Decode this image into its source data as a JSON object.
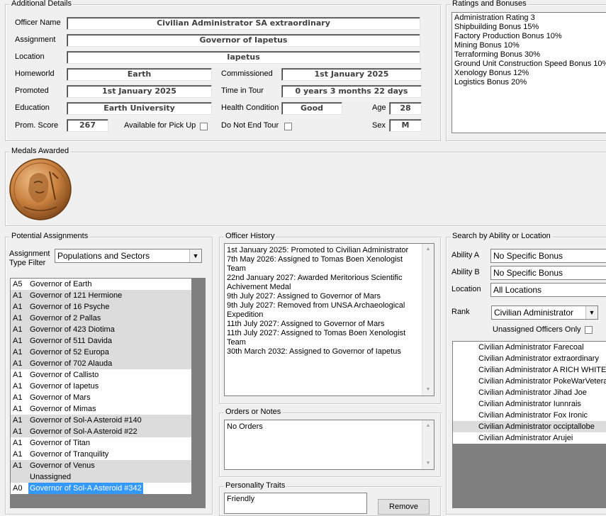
{
  "additional_details": {
    "title": "Additional Details",
    "officer_name_label": "Officer Name",
    "officer_name": "Civilian Administrator SA extraordinary",
    "assignment_label": "Assignment",
    "assignment": "Governor of Iapetus",
    "location_label": "Location",
    "location": "Iapetus",
    "homeworld_label": "Homeworld",
    "homeworld": "Earth",
    "commissioned_label": "Commissioned",
    "commissioned": "1st January 2025",
    "promoted_label": "Promoted",
    "promoted": "1st January 2025",
    "time_in_tour_label": "Time in Tour",
    "time_in_tour": "0 years 3 months 22 days",
    "education_label": "Education",
    "education": "Earth University",
    "health_label": "Health Condition",
    "health": "Good",
    "age_label": "Age",
    "age": "28",
    "prom_score_label": "Prom. Score",
    "prom_score": "267",
    "pickup_label": "Available for Pick Up",
    "do_not_end_tour_label": "Do Not End Tour",
    "sex_label": "Sex",
    "sex": "M"
  },
  "ratings": {
    "title": "Ratings and Bonuses",
    "items": [
      "Administration Rating 3",
      "Shipbuilding Bonus 15%",
      "Factory Production Bonus 10%",
      "Mining Bonus 10%",
      "Terraforming Bonus 30%",
      "Ground Unit Construction Speed Bonus 10%",
      "Xenology Bonus 12%",
      "Logistics Bonus 20%"
    ]
  },
  "medals": {
    "title": "Medals Awarded"
  },
  "potential": {
    "title": "Potential Assignments",
    "filter_label_1": "Assignment",
    "filter_label_2": "Type Filter",
    "filter_value": "Populations and Sectors",
    "items": [
      {
        "code": "A5",
        "name": "Governor of Earth",
        "alt": false
      },
      {
        "code": "A1",
        "name": "Governor of 121 Hermione",
        "alt": true
      },
      {
        "code": "A1",
        "name": "Governor of 16 Psyche",
        "alt": true
      },
      {
        "code": "A1",
        "name": "Governor of 2 Pallas",
        "alt": true
      },
      {
        "code": "A1",
        "name": "Governor of 423 Diotima",
        "alt": true
      },
      {
        "code": "A1",
        "name": "Governor of 511 Davida",
        "alt": true
      },
      {
        "code": "A1",
        "name": "Governor of 52 Europa",
        "alt": true
      },
      {
        "code": "A1",
        "name": "Governor of 702 Alauda",
        "alt": true
      },
      {
        "code": "A1",
        "name": "Governor of Callisto",
        "alt": false
      },
      {
        "code": "A1",
        "name": "Governor of Iapetus",
        "alt": false
      },
      {
        "code": "A1",
        "name": "Governor of Mars",
        "alt": false
      },
      {
        "code": "A1",
        "name": "Governor of Mimas",
        "alt": false
      },
      {
        "code": "A1",
        "name": "Governor of Sol-A Asteroid #140",
        "alt": true
      },
      {
        "code": "A1",
        "name": "Governor of Sol-A Asteroid #22",
        "alt": true
      },
      {
        "code": "A1",
        "name": "Governor of Titan",
        "alt": false
      },
      {
        "code": "A1",
        "name": "Governor of Tranquility",
        "alt": false
      },
      {
        "code": "A1",
        "name": "Governor of Venus",
        "alt": true
      },
      {
        "code": "",
        "name": "Unassigned",
        "alt": true
      },
      {
        "code": "A0",
        "name": "Governor of Sol-A Asteroid #342",
        "alt": false,
        "selected": true
      }
    ]
  },
  "history": {
    "title": "Officer History",
    "lines": [
      "1st January 2025: Promoted to Civilian Administrator",
      "7th May 2026: Assigned to Tomas Boen Xenologist Team",
      "22nd January 2027: Awarded Meritorious Scientific Achivement Medal",
      "9th July 2027: Assigned to Governor of Mars",
      "9th July 2027: Removed from UNSA Archaeological Expedition",
      "11th July 2027: Assigned to Governor of Mars",
      "11th July 2027: Assigned to Tomas Boen Xenologist Team",
      "30th March 2032: Assigned to Governor of Iapetus"
    ]
  },
  "orders": {
    "title": "Orders or Notes",
    "text": "No Orders"
  },
  "traits": {
    "title": "Personality Traits",
    "items": [
      "Friendly"
    ],
    "remove_label": "Remove"
  },
  "search": {
    "title": "Search by Ability or Location",
    "ability_a_label": "Ability A",
    "ability_a": "No Specific Bonus",
    "ability_b_label": "Ability B",
    "ability_b": "No Specific Bonus",
    "location_label": "Location",
    "location": "All Locations",
    "rank_label": "Rank",
    "rank": "Civilian Administrator",
    "unassigned_label": "Unassigned Officers Only",
    "results": [
      {
        "name": "Civilian Administrator Farecoal",
        "alt": false
      },
      {
        "name": "Civilian Administrator extraordinary",
        "alt": false
      },
      {
        "name": "Civilian Administrator A RICH WHITE MAN",
        "alt": false
      },
      {
        "name": "Civilian Administrator PokeWarVeteran",
        "alt": false
      },
      {
        "name": "Civilian Administrator Jihad Joe",
        "alt": false
      },
      {
        "name": "Civilian Administrator Iunnrais",
        "alt": false
      },
      {
        "name": "Civilian Administrator Fox Ironic",
        "alt": false
      },
      {
        "name": "Civilian Administrator occiptallobe",
        "alt": true
      },
      {
        "name": "Civilian Administrator Arujei",
        "alt": false
      }
    ]
  }
}
